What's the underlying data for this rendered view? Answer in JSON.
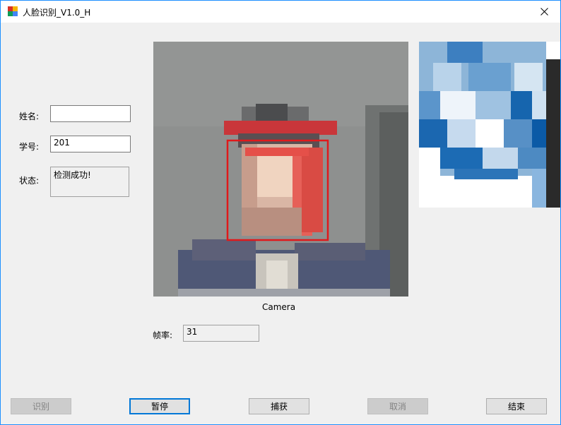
{
  "window": {
    "title": "人脸识别_V1.0_H"
  },
  "form": {
    "name_label": "姓名:",
    "name_value": "",
    "id_label": "学号:",
    "id_value": "201",
    "status_label": "状态:",
    "status_value": "检测成功!"
  },
  "camera": {
    "caption": "Camera",
    "fps_label": "帧率:",
    "fps_value": "31"
  },
  "buttons": {
    "recognize": "识别",
    "pause": "暂停",
    "capture": "捕获",
    "cancel": "取消",
    "end": "结束"
  },
  "colors": {
    "face_box": "#e0191b",
    "focus_border": "#0078d7",
    "window_border": "#1e90ff"
  }
}
